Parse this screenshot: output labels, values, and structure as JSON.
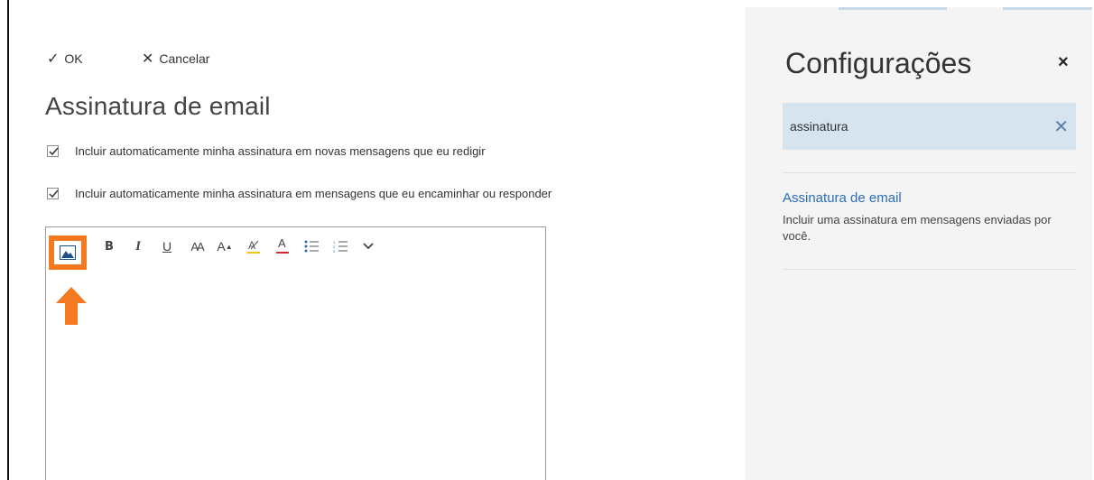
{
  "commands": {
    "ok_label": "OK",
    "cancel_label": "Cancelar"
  },
  "page": {
    "title": "Assinatura de email"
  },
  "options": [
    {
      "label": "Incluir automaticamente minha assinatura em novas mensagens que eu redigir",
      "checked": true
    },
    {
      "label": "Incluir automaticamente minha assinatura em mensagens que eu encaminhar ou responder",
      "checked": true
    }
  ],
  "toolbar": {
    "bold": "B",
    "italic": "I",
    "underline": "U",
    "font_size": "AA",
    "grow": "A",
    "font_color": "A"
  },
  "settings": {
    "title": "Configurações",
    "close": "×",
    "search_value": "assinatura",
    "search_clear": "✕",
    "result_title": "Assinatura de email",
    "result_desc": "Incluir uma assinatura em mensagens enviadas por você."
  },
  "colors": {
    "highlight": "#f47920",
    "link": "#2a6ebb",
    "search_bg": "#d6e4f0",
    "pane_bg": "#f4f4f4"
  },
  "icons": [
    "checkmark-icon",
    "close-icon",
    "insert-image-icon",
    "highlighter-icon",
    "bullets-icon",
    "numbering-icon",
    "chevron-down-icon",
    "up-arrow-icon"
  ]
}
